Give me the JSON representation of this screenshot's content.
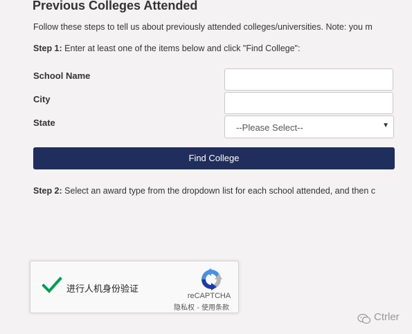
{
  "page": {
    "heading": "Previous Colleges Attended",
    "intro": "Follow these steps to tell us about previously attended colleges/universities. Note: you m",
    "step1_label": "Step 1:",
    "step1_text": " Enter at least one of the items below and click \"Find College\":",
    "step2_label": "Step 2:",
    "step2_text": " Select an award type from the dropdown list for each school attended, and then c"
  },
  "form": {
    "school_name_label": "School Name",
    "school_name_value": "",
    "city_label": "City",
    "city_value": "",
    "state_label": "State",
    "state_selected": "--Please Select--",
    "find_button": "Find College"
  },
  "recaptcha": {
    "verify_text": "进行人机身份验证",
    "brand": "reCAPTCHA",
    "links": "隐私权 - 使用条款",
    "check_icon": "checkmark-icon",
    "colors": {
      "check": "#009e55",
      "logo_blue": "#4a90e2",
      "logo_dark": "#1c3aa9",
      "logo_gray": "#b5b5b5"
    }
  },
  "watermark": {
    "text": "Ctrler",
    "icon": "wechat-icon"
  },
  "colors": {
    "background": "#f4f2f3",
    "button": "#1f2e5c"
  }
}
